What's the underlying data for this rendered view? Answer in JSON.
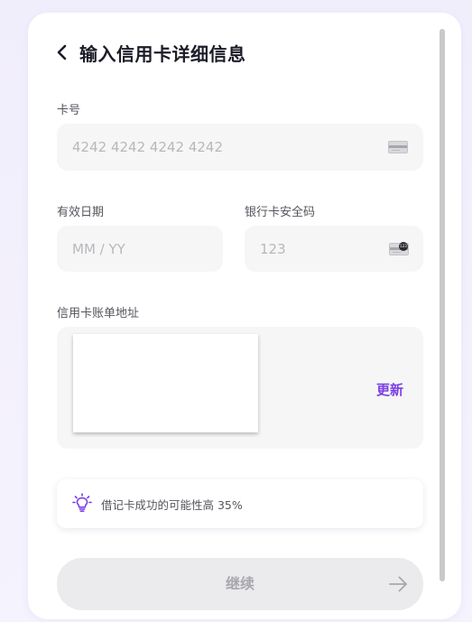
{
  "header": {
    "title": "输入信用卡详细信息",
    "back_icon": "chevron-left-icon"
  },
  "card_number": {
    "label": "卡号",
    "placeholder": "4242 4242 4242 4242",
    "value": "",
    "icon": "credit-card-icon"
  },
  "expiry": {
    "label": "有效日期",
    "placeholder": "MM / YY",
    "value": ""
  },
  "cvc": {
    "label": "银行卡安全码",
    "placeholder": "123",
    "value": "",
    "icon": "card-cvc-icon",
    "badge": "123"
  },
  "billing_address": {
    "label": "信用卡账单地址",
    "update_label": "更新"
  },
  "tip": {
    "icon": "lightbulb-icon",
    "text": "借记卡成功的可能性高 35%"
  },
  "continue_button": {
    "label": "继续",
    "icon": "arrow-right-icon"
  },
  "colors": {
    "accent": "#7b3fe4",
    "field_bg": "#f6f6f7",
    "button_disabled_bg": "#ebebed",
    "button_disabled_text": "#a7a7ad"
  }
}
